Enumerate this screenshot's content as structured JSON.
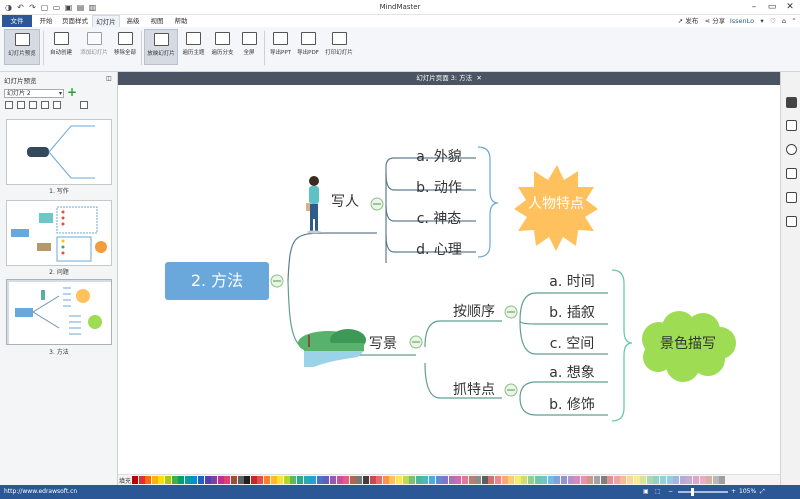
{
  "window": {
    "title": "MindMaster",
    "share_btn": "发布",
    "share2_btn": "分享",
    "user": "IssenLo"
  },
  "menu": {
    "file": "文件",
    "tabs": [
      "开始",
      "页面样式",
      "幻灯片",
      "高级",
      "视图",
      "帮助"
    ]
  },
  "ribbon": [
    "幻灯片预览",
    "自动创建",
    "添加幻灯片",
    "移除全部",
    "放映幻灯片",
    "遍历主题",
    "遍历分支",
    "全屏",
    "导出PPT",
    "导出PDF",
    "打印幻灯片"
  ],
  "left_panel": {
    "title": "幻灯片预览",
    "selected": "幻灯片 2",
    "thumbs": [
      "1. 写作",
      "2. 问题",
      "3. 方法"
    ]
  },
  "canvas_tab": "幻灯片页面 3: 方法",
  "mindmap": {
    "root": "2. 方法",
    "b1": "写人",
    "b1_leaves": [
      "a. 外貌",
      "b. 动作",
      "c. 神态",
      "d. 心理"
    ],
    "b1_note": "人物特点",
    "b2": "写景",
    "b2a": "按顺序",
    "b2a_leaves": [
      "a. 时间",
      "b. 插叙",
      "c. 空间"
    ],
    "b2b": "抓特点",
    "b2b_leaves": [
      "a. 想象",
      "b. 修饰"
    ],
    "b2_note": "景色描写"
  },
  "palette_label": "填充",
  "status": {
    "url": "http://www.edrawsoft.cn",
    "fill": "填充",
    "zoom": "105%"
  },
  "colors": {
    "root": "#6aa8dc",
    "accent": "#2b5797",
    "sun": "#ffc15e",
    "cloud": "#9ddc53"
  }
}
